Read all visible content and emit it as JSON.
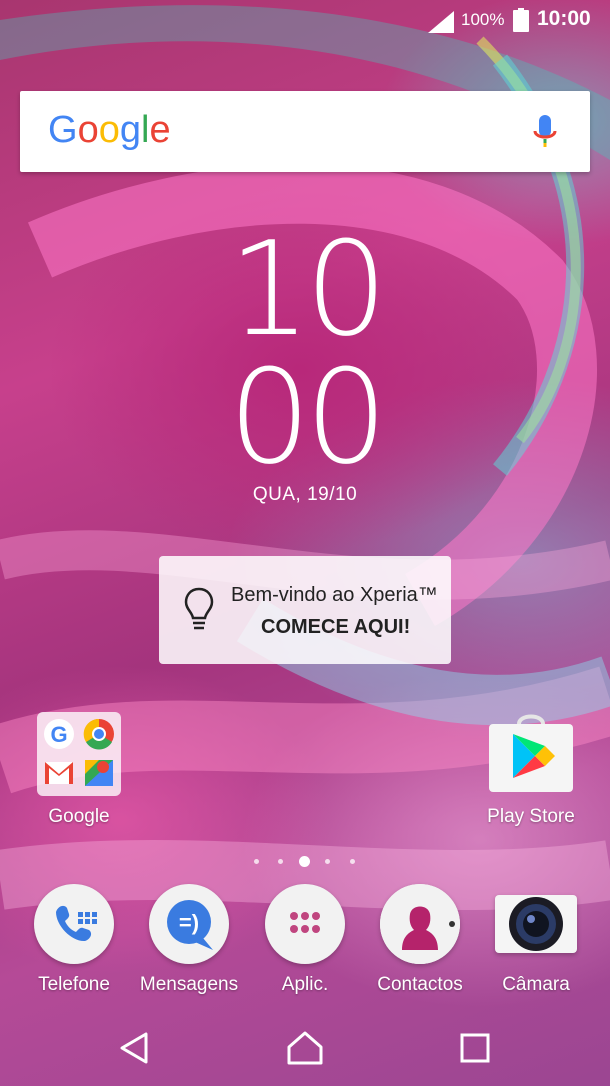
{
  "status_bar": {
    "battery_percent": "100%",
    "time": "10:00",
    "signal_icon": "signal-icon",
    "battery_icon": "battery-full-icon"
  },
  "search_widget": {
    "logo": "Google",
    "mic_icon": "mic-icon"
  },
  "clock": {
    "hours": "10",
    "minutes": "00",
    "date": "QUA, 19/10"
  },
  "welcome_card": {
    "line1": "Bem-vindo ao Xperia™",
    "line2": "COMECE AQUI!",
    "icon": "lightbulb-icon"
  },
  "home_apps": [
    {
      "label": "Google",
      "icon": "google-folder-icon"
    },
    {
      "label": "Play Store",
      "icon": "play-store-icon"
    }
  ],
  "page_indicator": {
    "count": 5,
    "active_index": 2
  },
  "dock": [
    {
      "label": "Telefone",
      "icon": "phone-icon"
    },
    {
      "label": "Mensagens",
      "icon": "messages-icon"
    },
    {
      "label": "Aplic.",
      "icon": "apps-grid-icon"
    },
    {
      "label": "Contactos",
      "icon": "contacts-icon"
    },
    {
      "label": "Câmara",
      "icon": "camera-icon"
    }
  ],
  "nav_bar": {
    "back_icon": "back-icon",
    "home_icon": "home-icon",
    "recents_icon": "recents-icon"
  },
  "colors": {
    "google_blue": "#4285F4",
    "google_red": "#EA4335",
    "google_yellow": "#FBBC05",
    "google_green": "#34A853",
    "wallpaper_pink": "#C7408C"
  }
}
